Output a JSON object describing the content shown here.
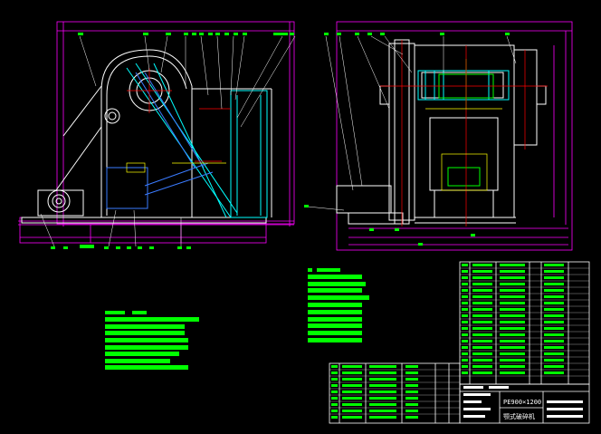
{
  "colors": {
    "background": "#000000",
    "outline": "#ffffff",
    "text_block": "#00ff00",
    "dimension": "#ff00ff",
    "centerline": "#ff0000",
    "hidden": "#ffff00",
    "detail_blue": "#00a0ff",
    "detail_cyan": "#00ffff"
  },
  "title_block": {
    "model": "PE900×1200",
    "name": "颚式破碎机"
  }
}
